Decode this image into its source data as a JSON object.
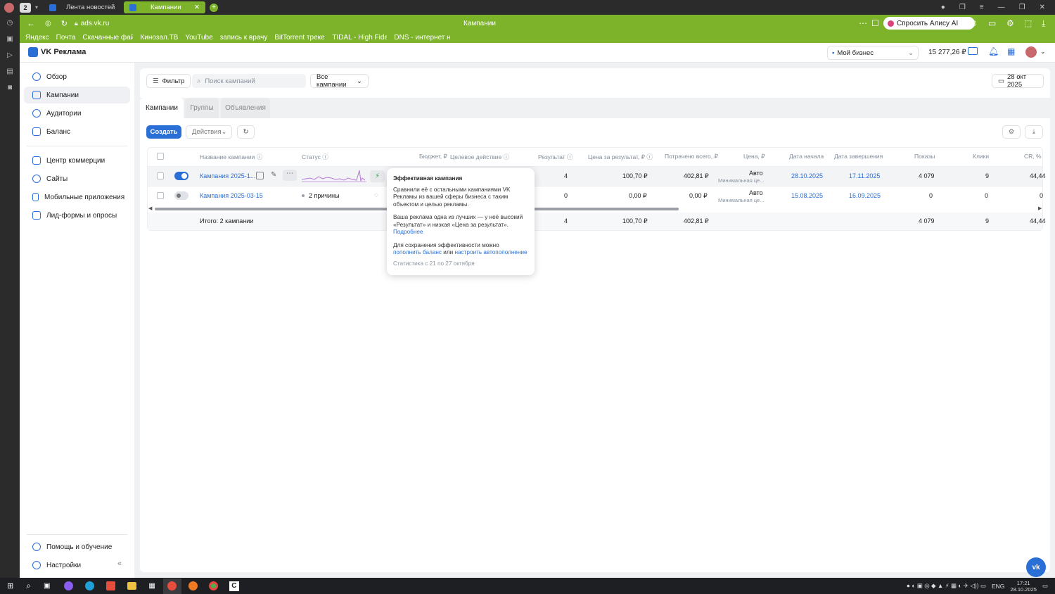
{
  "browser": {
    "tabs": [
      {
        "label": "Лента новостей"
      },
      {
        "label": "Кампании"
      }
    ],
    "tab_count": "2",
    "url": "ads.vk.ru",
    "page_title": "Кампании",
    "alice": "Спросить Алису AI",
    "bookmarks": [
      "Яндекс",
      "Почта",
      "Скачанные файлы",
      "Кинозал.ТВ",
      "YouTube",
      "запись к врачу",
      "BitTorrent трекер",
      "TIDAL - High Fidel",
      "DNS - интернет н"
    ]
  },
  "header": {
    "logo": "VK Реклама",
    "account": "Мой бизнес",
    "balance": "15 277,26 ₽"
  },
  "sidebar": {
    "items": [
      {
        "label": "Обзор"
      },
      {
        "label": "Кампании"
      },
      {
        "label": "Аудитории"
      },
      {
        "label": "Баланс"
      },
      {
        "label": "Центр коммерции"
      },
      {
        "label": "Сайты"
      },
      {
        "label": "Мобильные приложения"
      },
      {
        "label": "Лид-формы и опросы"
      }
    ],
    "help": "Помощь и обучение",
    "settings": "Настройки"
  },
  "toolbar": {
    "filter": "Фильтр",
    "search_placeholder": "Поиск кампаний",
    "scope": "Все кампании",
    "date": "28 окт 2025"
  },
  "tabs": [
    "Кампании",
    "Группы",
    "Объявления"
  ],
  "actions": {
    "create": "Создать",
    "actions": "Действия"
  },
  "table": {
    "headers": {
      "name": "Название кампании",
      "status": "Статус",
      "budget": "Бюджет, ₽",
      "goal": "Целевое действие",
      "result": "Результат",
      "cpr": "Цена за результат, ₽",
      "spent": "Потрачено всего, ₽",
      "price": "Цена, ₽",
      "start": "Дата начала",
      "end": "Дата завершения",
      "shows": "Показы",
      "clicks": "Клики",
      "cr": "CR, %"
    },
    "rows": [
      {
        "name": "Кампания 2025-1...",
        "status": "",
        "result": "4",
        "cpr": "100,70 ₽",
        "spent": "402,81 ₽",
        "price": "Авто",
        "price_sub": "Минимальная це...",
        "start": "28.10.2025",
        "end": "17.11.2025",
        "shows": "4 079",
        "clicks": "9",
        "cr": "44,44"
      },
      {
        "name": "Кампания 2025-03-15",
        "status": "2 причины",
        "result": "0",
        "cpr": "0,00 ₽",
        "spent": "0,00 ₽",
        "price": "Авто",
        "price_sub": "Минимальная це...",
        "start": "15.08.2025",
        "end": "16.09.2025",
        "shows": "0",
        "clicks": "0",
        "cr": "0"
      }
    ],
    "total": {
      "label": "Итого: 2 кампании",
      "result": "4",
      "cpr": "100,70 ₽",
      "spent": "402,81 ₽",
      "shows": "4 079",
      "clicks": "9",
      "cr": "44,44"
    }
  },
  "tooltip": {
    "title": "Эффективная кампания",
    "p1": "Сравнили её с остальными кампаниями VK Рекламы из вашей сферы бизнеса с таким объектом и целью рекламы.",
    "p2": "Ваша реклама одна из лучших — у неё высокий «Результат» и низкая «Цена за результат».",
    "more": "Подробнее",
    "p3a": "Для сохранения эффективности можно",
    "link1": "пополнить баланс",
    "or": "или",
    "link2": "настроить автопополнение",
    "stats": "Статистика с 21 по 27 октября"
  },
  "taskbar": {
    "lang": "ENG",
    "time": "17:21",
    "date": "28.10.2025"
  },
  "colors": {
    "accent": "#2a6fd6",
    "browser_green": "#7cb32a"
  }
}
